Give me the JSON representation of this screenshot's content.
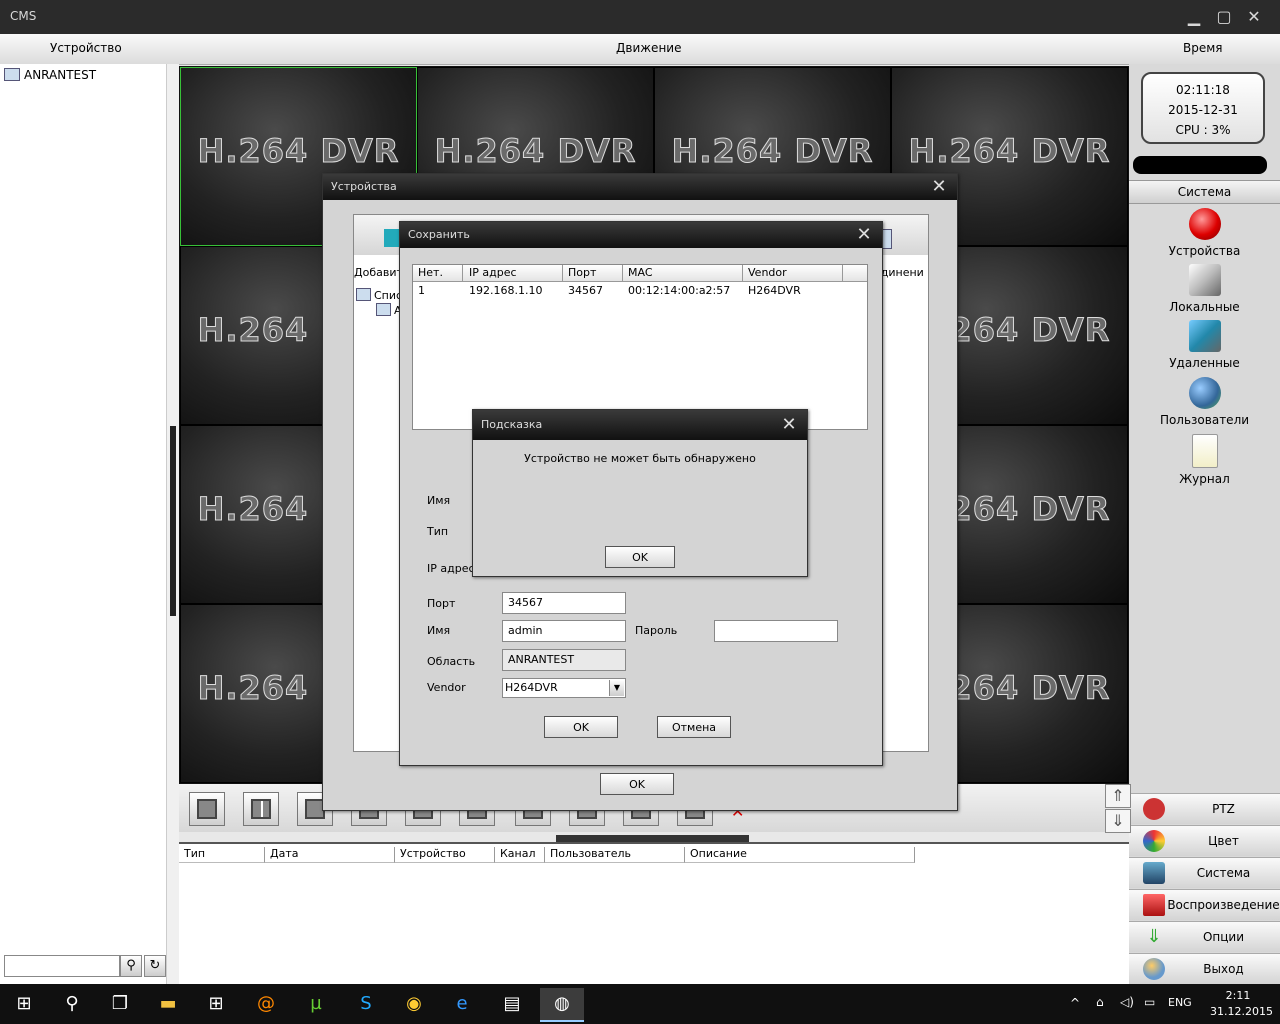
{
  "window": {
    "title": "CMS"
  },
  "header": {
    "device_label": "Устройство",
    "motion_label": "Движение",
    "time_label": "Время"
  },
  "left_panel": {
    "tree_root": "ANRANTEST",
    "search_placeholder": ""
  },
  "grid": {
    "cell_label": "H.264 DVR"
  },
  "right_panel": {
    "clock": {
      "time": "02:11:18",
      "date": "2015-12-31",
      "cpu": "CPU : 3%"
    },
    "section_title": "Система",
    "items": [
      {
        "label": "Устройства",
        "icon": "device-red-icon"
      },
      {
        "label": "Локальные",
        "icon": "local-config-icon"
      },
      {
        "label": "Удаленные",
        "icon": "remote-config-icon"
      },
      {
        "label": "Пользователи",
        "icon": "users-icon"
      },
      {
        "label": "Журнал",
        "icon": "log-document-icon"
      }
    ],
    "bottom_buttons": [
      {
        "label": "PTZ",
        "color": "#c33"
      },
      {
        "label": "Цвет",
        "color": "#3a8"
      },
      {
        "label": "Система",
        "color": "#468"
      },
      {
        "label": "Воспроизведение",
        "color": "#c44"
      },
      {
        "label": "Опции",
        "color": "#3a3"
      },
      {
        "label": "Выход",
        "color": "#69c"
      }
    ]
  },
  "events_table": {
    "columns": [
      "Тип",
      "Дата",
      "Устройство",
      "Канал",
      "Пользователь",
      "Описание"
    ]
  },
  "devices_dialog": {
    "title": "Устройства",
    "add_label": "Добавит",
    "list_label": "Спис",
    "sub_item": "A",
    "connect_label": "единени",
    "ok_label": "OK"
  },
  "save_dialog": {
    "title": "Сохранить",
    "columns": [
      "Нет.",
      "IP адрес",
      "Порт",
      "MAC",
      "Vendor"
    ],
    "rows": [
      {
        "no": "1",
        "ip": "192.168.1.10",
        "port": "34567",
        "mac": "00:12:14:00:a2:57",
        "vendor": "H264DVR"
      }
    ],
    "name_label": "Имя",
    "type_label": "Тип",
    "ip_label": "IP адрес",
    "port_label": "Порт",
    "port_value": "34567",
    "user_label": "Имя",
    "user_value": "admin",
    "password_label": "Пароль",
    "password_value": "",
    "area_label": "Область",
    "area_value": "ANRANTEST",
    "vendor_label": "Vendor",
    "vendor_value": "H264DVR",
    "ok_label": "OK",
    "cancel_label": "Отмена"
  },
  "hint_dialog": {
    "title": "Подсказка",
    "message": "Устройство не может быть обнаружено",
    "ok_label": "OK"
  },
  "taskbar": {
    "lang": "ENG",
    "time": "2:11",
    "date": "31.12.2015"
  }
}
